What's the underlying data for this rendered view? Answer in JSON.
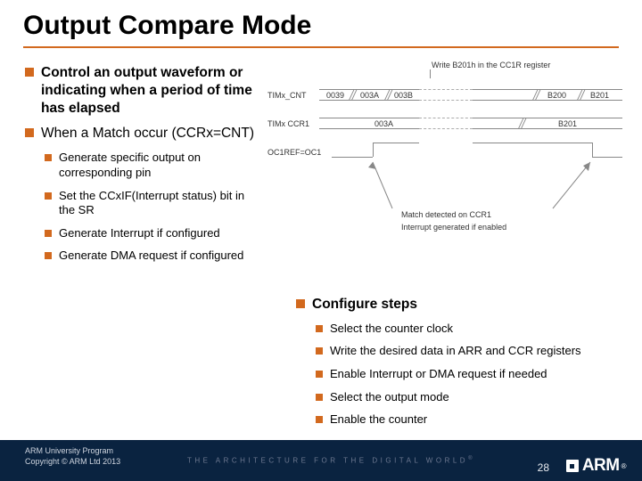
{
  "title": "Output Compare Mode",
  "left": {
    "b1": "Control an output waveform or indicating when a period of time has elapsed",
    "b2": "When a Match occur (CCRx=CNT)",
    "s1": "Generate specific output on corresponding pin",
    "s2": "Set the CCxIF(Interrupt status) bit in the SR",
    "s3": "Generate Interrupt if configured",
    "s4": "Generate DMA request if configured"
  },
  "right": {
    "heading": "Configure steps",
    "s1": "Select the counter clock",
    "s2": "Write the desired data in ARR and CCR registers",
    "s3": "Enable Interrupt or DMA request if needed",
    "s4": "Select the output mode",
    "s5": "Enable the counter"
  },
  "diagram": {
    "note_top": "Write B201h in the CC1R register",
    "row_cnt_label": "TIMx_CNT",
    "row_ccr_label": "TIMx  CCR1",
    "row_ocref_label": "OC1REF=OC1",
    "cnt_vals": [
      "0039",
      "003A",
      "003B",
      "B200",
      "B201"
    ],
    "ccr_vals": [
      "003A",
      "B201"
    ],
    "annot_match": "Match detected on CCR1",
    "annot_int": "Interrupt generated if enabled"
  },
  "footer": {
    "l1": "ARM University Program",
    "l2": "Copyright © ARM Ltd 2013",
    "tagline": "THE ARCHITECTURE FOR THE DIGITAL WORLD",
    "page": "28",
    "logo": "ARM"
  }
}
